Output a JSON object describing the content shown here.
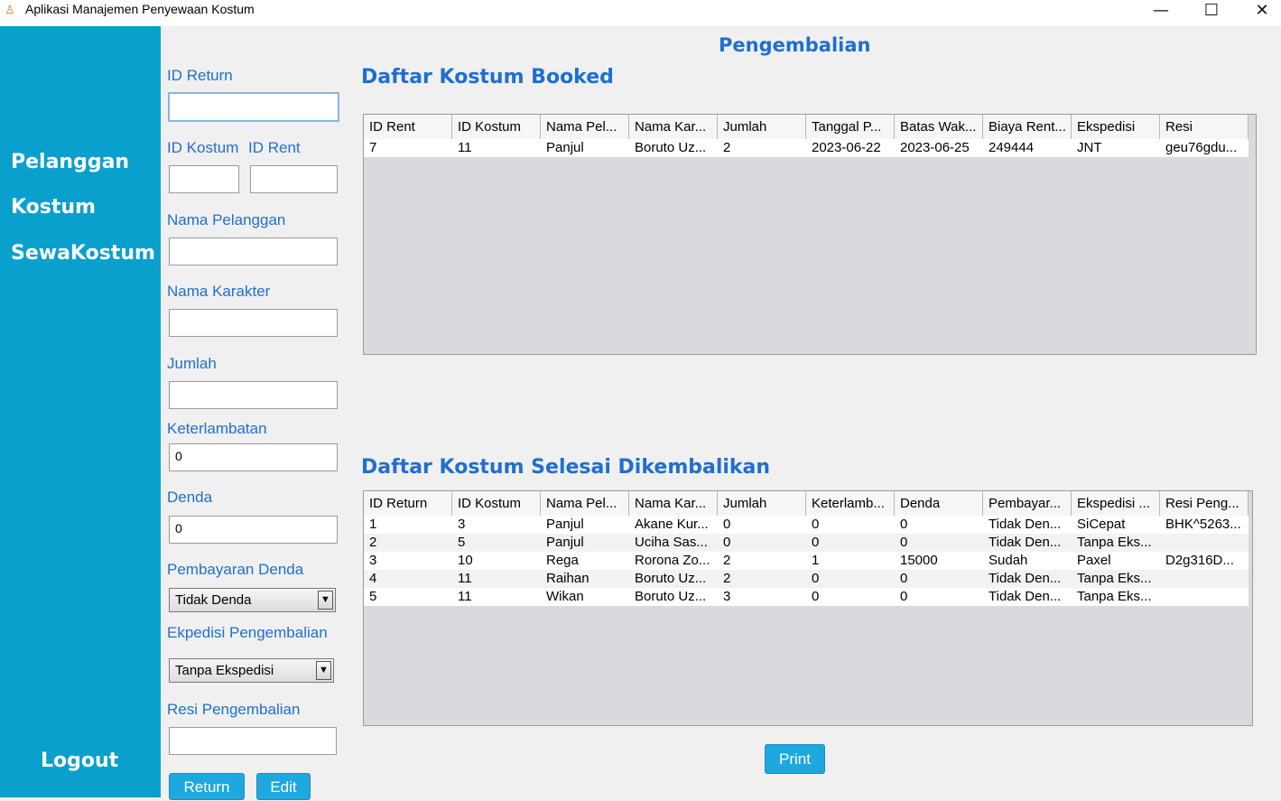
{
  "window": {
    "title": "Aplikasi Manajemen Penyewaan Kostum",
    "minimize": "—",
    "maximize": "☐",
    "close": "✕"
  },
  "sidebar": {
    "items": [
      {
        "label": "Pelanggan"
      },
      {
        "label": "Kostum"
      },
      {
        "label": "SewaKostum"
      }
    ],
    "logout": "Logout"
  },
  "form": {
    "id_return_label": "ID Return",
    "id_return_value": "",
    "id_kostum_label": "ID Kostum",
    "id_kostum_value": "",
    "id_rent_label": "ID Rent",
    "id_rent_value": "",
    "nama_pelanggan_label": "Nama Pelanggan",
    "nama_pelanggan_value": "",
    "nama_karakter_label": "Nama Karakter",
    "nama_karakter_value": "",
    "jumlah_label": "Jumlah",
    "jumlah_value": "",
    "keterlambatan_label": "Keterlambatan",
    "keterlambatan_value": "0",
    "denda_label": "Denda",
    "denda_value": "0",
    "pembayaran_label": "Pembayaran Denda",
    "pembayaran_selected": "Tidak Denda",
    "ekspedisi_label": "Ekpedisi Pengembalian",
    "ekspedisi_selected": "Tanpa Ekspedisi",
    "resi_label": "Resi Pengembalian",
    "resi_value": "",
    "return_button": "Return",
    "edit_button": "Edit"
  },
  "main": {
    "page_title": "Pengembalian",
    "booked_title": "Daftar Kostum Booked",
    "returned_title": "Daftar Kostum Selesai Dikembalikan",
    "print_button": "Print"
  },
  "booked_table": {
    "headers": [
      "ID Rent",
      "ID Kostum",
      "Nama Pel...",
      "Nama Kar...",
      "Jumlah",
      "Tanggal P...",
      "Batas Wak...",
      "Biaya Rent...",
      "Ekspedisi",
      "Resi"
    ],
    "rows": [
      [
        "7",
        "11",
        "Panjul",
        "Boruto Uz...",
        "2",
        "2023-06-22",
        "2023-06-25",
        "249444",
        "JNT",
        "geu76gdu..."
      ]
    ]
  },
  "returned_table": {
    "headers": [
      "ID Return",
      "ID Kostum",
      "Nama Pel...",
      "Nama Kar...",
      "Jumlah",
      "Keterlamb...",
      "Denda",
      "Pembayar...",
      "Ekspedisi ...",
      "Resi Peng..."
    ],
    "rows": [
      [
        "1",
        "3",
        "Panjul",
        "Akane Kur...",
        "0",
        "0",
        "0",
        "Tidak Den...",
        "SiCepat",
        "BHK^5263..."
      ],
      [
        "2",
        "5",
        "Panjul",
        "Uciha Sas...",
        "0",
        "0",
        "0",
        "Tidak Den...",
        "Tanpa Eks...",
        ""
      ],
      [
        "3",
        "10",
        "Rega",
        "Rorona Zo...",
        "2",
        "1",
        "15000",
        "Sudah",
        "Paxel",
        "D2g316D..."
      ],
      [
        "4",
        "11",
        "Raihan",
        "Boruto Uz...",
        "2",
        "0",
        "0",
        "Tidak Den...",
        "Tanpa Eks...",
        ""
      ],
      [
        "5",
        "11",
        "Wikan",
        "Boruto Uz...",
        "3",
        "0",
        "0",
        "Tidak Den...",
        "Tanpa Eks...",
        ""
      ]
    ]
  }
}
